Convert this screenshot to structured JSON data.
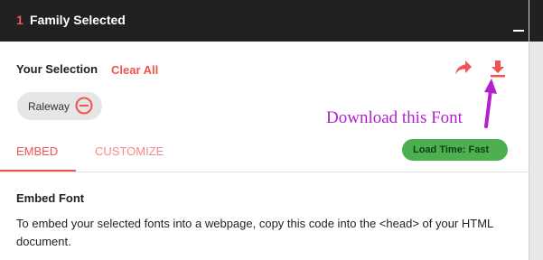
{
  "header": {
    "count": "1",
    "title": "Family Selected"
  },
  "selection": {
    "label": "Your Selection",
    "clear_all": "Clear All",
    "share_icon": "share-arrow-icon",
    "download_icon": "download-icon",
    "chips": [
      {
        "name": "Raleway",
        "remove_icon": "remove-circle-icon"
      }
    ]
  },
  "annotation": {
    "text": "Download this Font",
    "color": "#b21fcc"
  },
  "tabs": [
    {
      "label": "EMBED",
      "active": true
    },
    {
      "label": "CUSTOMIZE",
      "active": false
    }
  ],
  "load_time": "Load Time: Fast",
  "embed": {
    "title": "Embed Font",
    "description": "To embed your selected fonts into a webpage, copy this code into the <head> of your HTML document."
  },
  "colors": {
    "header_bg": "#212121",
    "accent": "#f15350",
    "badge_green": "#4caf50"
  }
}
